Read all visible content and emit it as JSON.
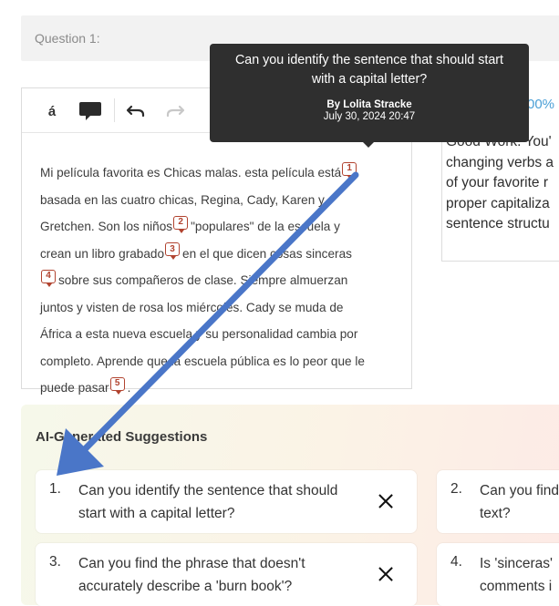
{
  "question": {
    "label": "Question 1:"
  },
  "toolbar": {
    "accent_label": "á",
    "comment_icon": "speech-bubble-icon",
    "undo_icon": "undo-icon",
    "redo_icon": "redo-icon"
  },
  "essay": {
    "segments": [
      "Mi película favorita es Chicas malas. esta película está",
      "basada en las cuatro chicas, Regina, Cady, Karen y",
      "Gretchen. Son los niños",
      "\"populares\" de la escuela y",
      "crean un libro grabado",
      "en el que dicen cosas sinceras",
      "sobre sus compañeros de clase. Siempre almuerzan",
      "juntos y visten de rosa los miércoles. Cady se muda de",
      "África a esta nueva escuela y su personalidad cambia por",
      "completo. Aprende que la escuela pública es lo peor que le",
      "puede pasar",
      "."
    ],
    "markers": [
      "1",
      "2",
      "3",
      "4",
      "5"
    ]
  },
  "tooltip": {
    "question": "Can you identify the sentence that should start with a capital letter?",
    "author": "By Lolita Stracke",
    "date": "July 30, 2024 20:47"
  },
  "feedback": {
    "percent": "00%",
    "lines": [
      "Good Work. You'",
      "changing verbs a",
      "of your favorite r",
      "proper capitaliza",
      "sentence structu"
    ]
  },
  "suggestions": {
    "title": "AI-Generated Suggestions",
    "cards": [
      {
        "num": "1.",
        "line1": "Can you identify the sentence that should",
        "line2": "start with a capital letter?"
      },
      {
        "num": "2.",
        "line1": "Can you find",
        "line2": "text?"
      },
      {
        "num": "3.",
        "line1": "Can you find the phrase that doesn't",
        "line2": "accurately describe a 'burn book'?"
      },
      {
        "num": "4.",
        "line1": "Is 'sinceras'",
        "line2": "comments i"
      }
    ]
  },
  "colors": {
    "marker": "#b1432f",
    "arrow": "#4a76c8",
    "tooltip_bg": "#2f2f2f",
    "accent": "#4a9fd6"
  }
}
